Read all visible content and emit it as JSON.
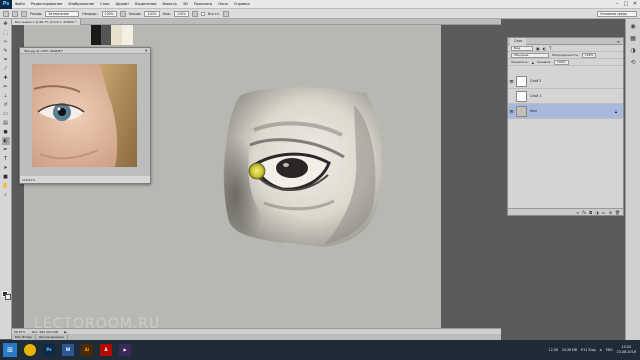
{
  "app": {
    "logo": "Ps",
    "brand_color": "#0a2a4a"
  },
  "menu": [
    "Файл",
    "Редактирование",
    "Изображение",
    "Слои",
    "Шрифт",
    "Выделение",
    "Фильтр",
    "3D",
    "Просмотр",
    "Окно",
    "Справка"
  ],
  "window_controls": {
    "minimize": "–",
    "maximize": "□",
    "close": "✕"
  },
  "options": {
    "mode_label": "Режим:",
    "mode_value": "Затемнение",
    "opacity_label": "Непрозр.:",
    "opacity_value": "100%",
    "pressure_label": "Нажим:",
    "pressure_value": "100%",
    "flow_label": "Наж:",
    "flow_value": "100%",
    "all_layers_label": "Все сл.",
    "workspace": "Основная среда"
  },
  "document": {
    "tab_title": "Без имени-1 @ 66,7% (Слой 1, RGB/8) *",
    "zoom": "66,67%",
    "doc_info": "Док: 982,2K/2,8M"
  },
  "reference_window": {
    "title": "IMG.jpg @ 118% (RGB/8)*",
    "close": "✕",
    "zoom": "118,67%"
  },
  "watermark": "LECTOROOM.RU",
  "bottom_tabs": [
    "Mini Bridge",
    "Шкала времени"
  ],
  "layers_panel": {
    "tab": "Слои",
    "menu_icon": "≡",
    "kind_label": "Вид",
    "blend_mode": "Обычные",
    "opacity_label": "Непрозрачность:",
    "opacity_value": "100%",
    "lock_label": "Закрепить:",
    "fill_label": "Заливка:",
    "fill_value": "100%",
    "layers": [
      {
        "name": "Слой 2",
        "visible": true,
        "selected": false,
        "background": false
      },
      {
        "name": "Слой 1",
        "visible": false,
        "selected": false,
        "background": false
      },
      {
        "name": "Фон",
        "visible": true,
        "selected": true,
        "background": true
      }
    ],
    "footer_icons": [
      "link-icon",
      "fx-icon",
      "mask-icon",
      "adjustment-icon",
      "folder-icon",
      "new-layer-icon",
      "trash-icon"
    ]
  },
  "taskbar": {
    "apps": [
      "Chrome",
      "Ps",
      "Word",
      "Ai",
      "Acrobat",
      "Media"
    ],
    "tray_left": "12,06",
    "tray_mid": "24,38 MB",
    "tray_vol": "P.11 Stop",
    "lang": "ENG",
    "time": "13:20",
    "date": "23.08.2016"
  }
}
